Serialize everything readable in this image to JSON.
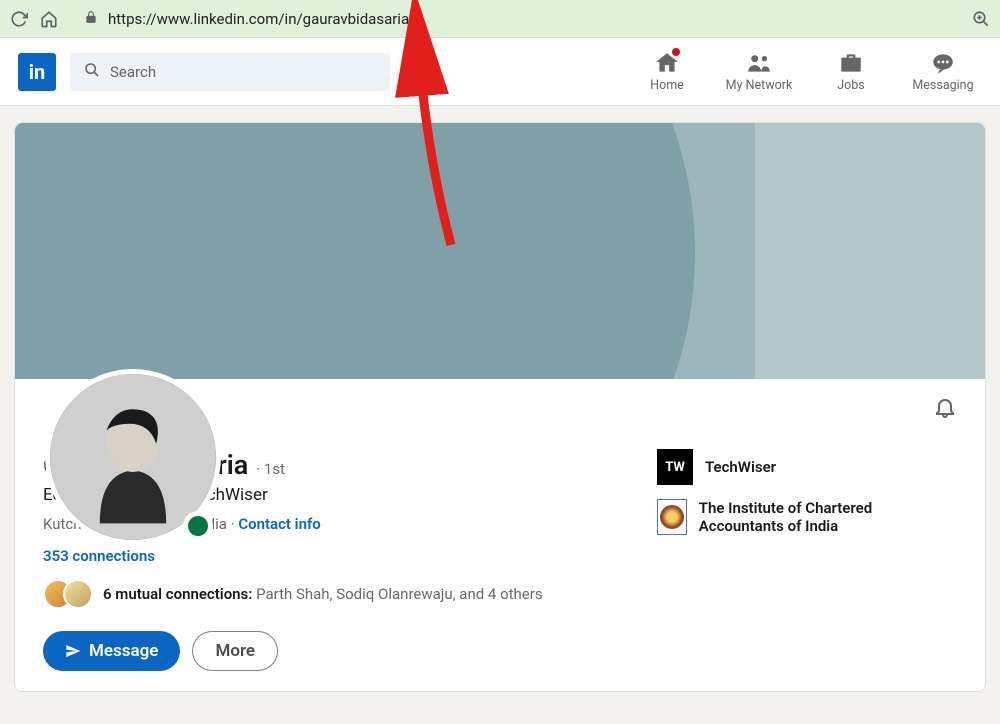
{
  "browser": {
    "url": "https://www.linkedin.com/in/gauravbidasaria/"
  },
  "nav": {
    "logo": "in",
    "search_placeholder": "Search",
    "items": [
      "Home",
      "My Network",
      "Jobs",
      "Messaging"
    ]
  },
  "profile": {
    "name": "Gaurav Bidasaria",
    "degree": "· 1st",
    "headline": "Editor and Writer @TechWiser",
    "location": "Kutch District, Gujarat, India · ",
    "contact_info": "Contact info",
    "connections": "353 connections",
    "mutual_label": "6 mutual connections:",
    "mutual_names": " Parth Shah, Sodiq Olanrewaju, and 4 others",
    "message_btn": "Message",
    "more_btn": "More",
    "orgs": [
      {
        "name": "TechWiser"
      },
      {
        "name": "The Institute of Chartered Accountants of India"
      }
    ]
  }
}
